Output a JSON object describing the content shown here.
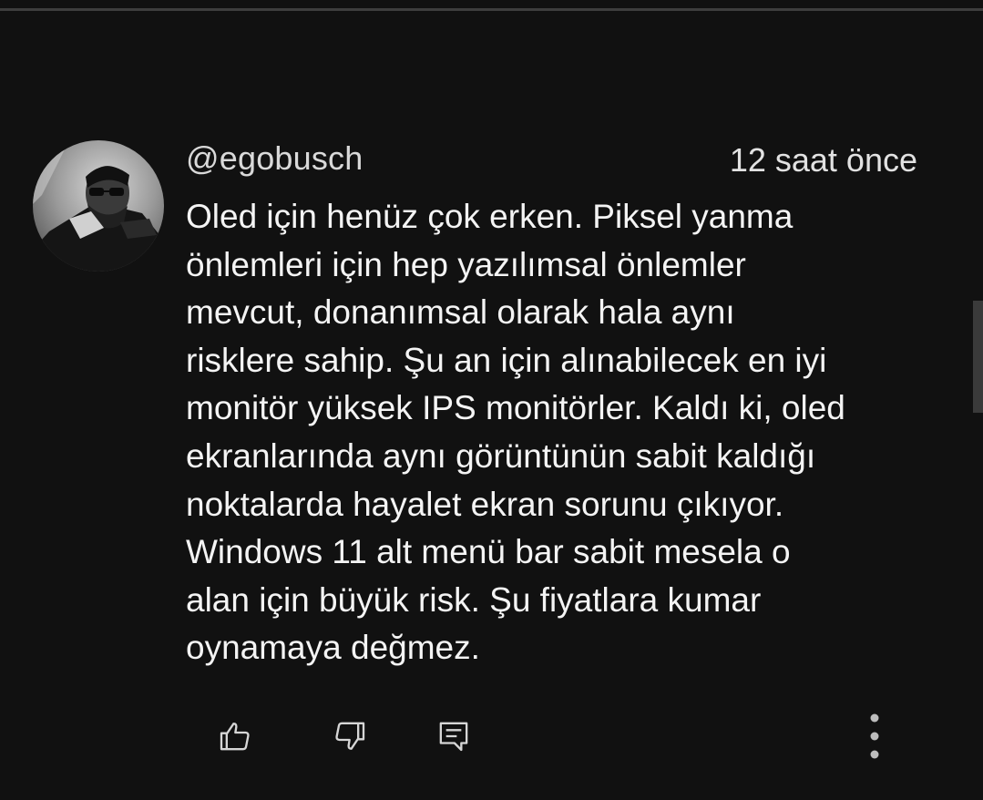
{
  "comment": {
    "handle": "@egobusch",
    "timestamp": "12 saat önce",
    "lines": [
      "Oled için henüz çok erken. Piksel yanma",
      "önlemleri için hep yazılımsal önlemler",
      "mevcut, donanımsal olarak hala aynı",
      "risklere sahip. Şu an için alınabilecek en iyi",
      "monitör yüksek IPS monitörler. Kaldı ki, oled",
      "ekranlarında aynı görüntünün sabit kaldığı",
      "noktalarda hayalet ekran sorunu çıkıyor.",
      "Windows 11 alt menü bar sabit mesela o",
      "alan için büyük risk. Şu fiyatlara kumar",
      "oynamaya değmez."
    ]
  },
  "actions": {
    "like_icon": "thumbs-up-icon",
    "dislike_icon": "thumbs-down-icon",
    "reply_icon": "comment-icon",
    "more_icon": "more-vertical-icon"
  },
  "colors": {
    "background": "#111111",
    "text": "#f4f4f4",
    "handle": "#d9d9d9",
    "icon": "#d6d6d6"
  }
}
